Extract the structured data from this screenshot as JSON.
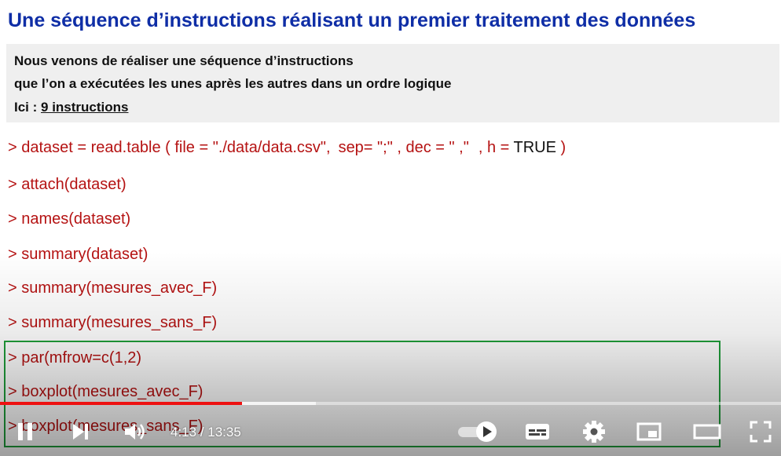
{
  "slide": {
    "title": "Une séquence d’instructions réalisant un premier traitement des données",
    "note": {
      "line1": "Nous venons de réaliser une séquence d’instructions",
      "line2": "que l’on a exécutées les unes après les autres dans un ordre logique",
      "line3_prefix": "Ici : ",
      "line3_count": "9 instructions"
    },
    "code": {
      "line1": {
        "a": "> dataset = read.table ( file = \"./data/data.csv\",",
        "b": "sep= \";\" , dec = \" ,\"",
        "c": ", h = ",
        "d": "TRUE",
        "e": " )"
      },
      "line2": "> attach(dataset)",
      "line3": "> names(dataset)",
      "line4": "> summary(dataset)",
      "line5": "> summary(mesures_avec_F)",
      "line6": "> summary(mesures_sans_F)",
      "line7": "> par(mfrow=c(1,2)",
      "line8": "> boxplot(mesures_avec_F)",
      "line9": "> boxplot(mesures_sans_F)"
    }
  },
  "player": {
    "time_current": "4:13",
    "time_separator": " / ",
    "time_total": "13:35",
    "progress_played_fraction": 0.31,
    "progress_buffered_fraction": 0.404,
    "accent_color": "#ee1111",
    "icons": [
      "pause-icon",
      "next-icon",
      "volume-icon",
      "autoplay-toggle-icon",
      "subtitles-icon",
      "settings-gear-icon",
      "miniplayer-icon",
      "theater-mode-icon",
      "fullscreen-icon"
    ]
  }
}
